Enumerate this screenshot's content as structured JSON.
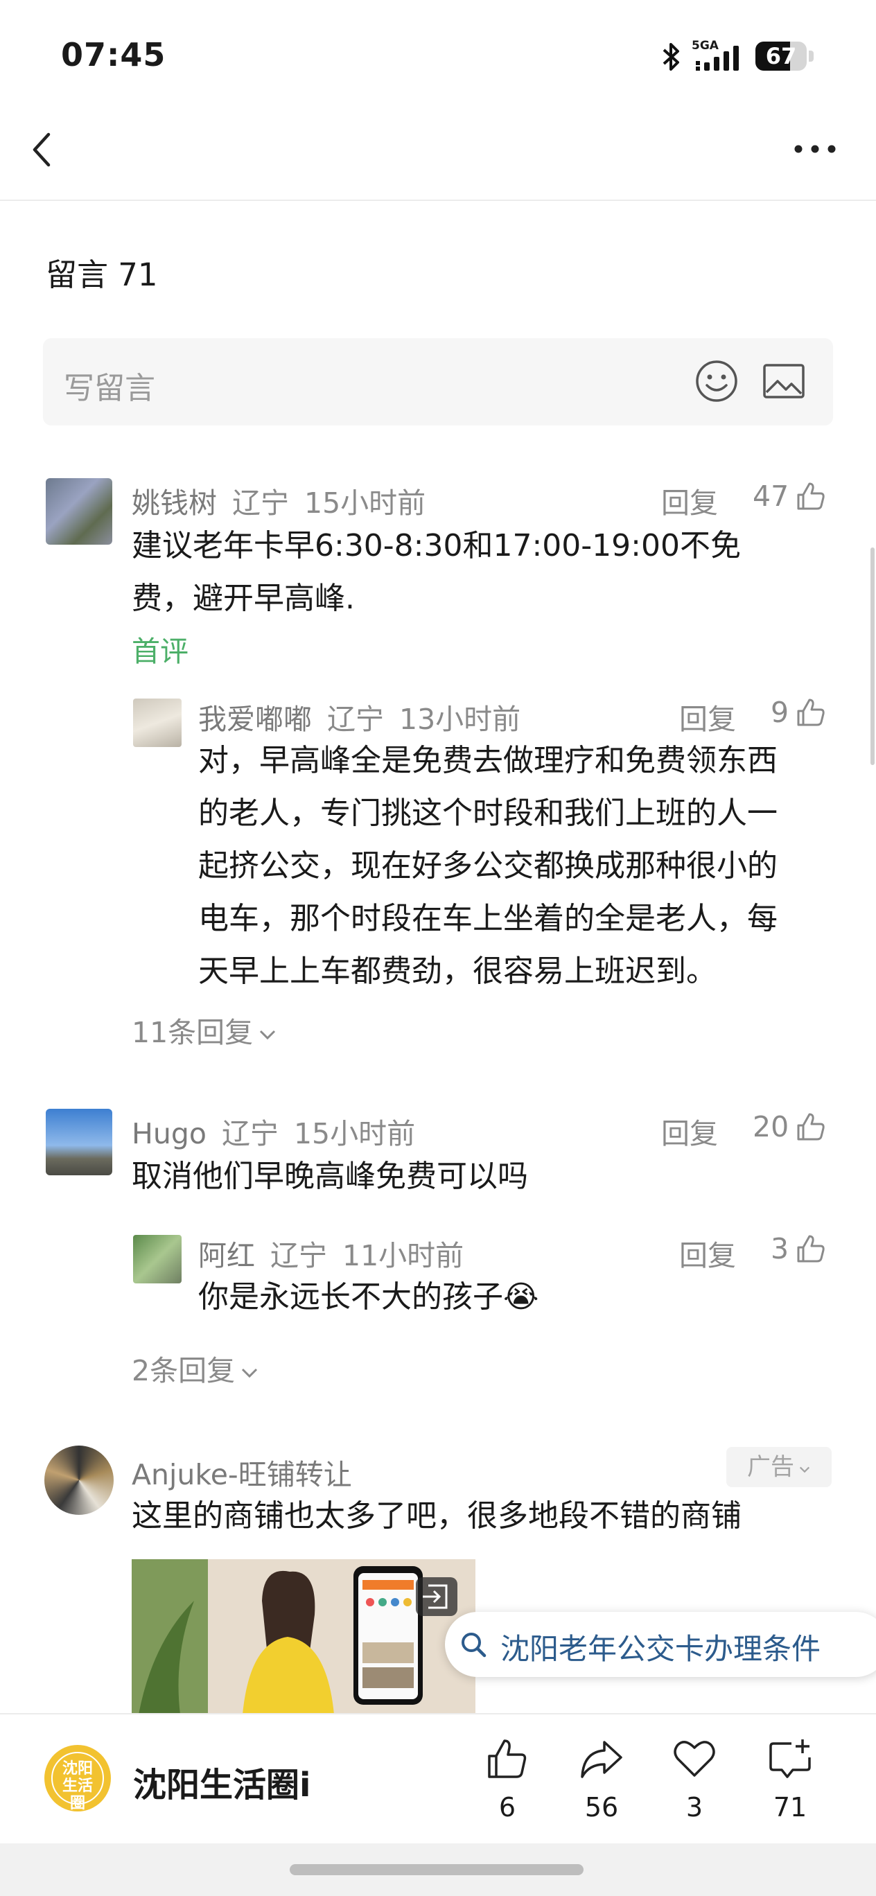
{
  "status_bar": {
    "time": "07:45",
    "network": "5GA",
    "battery": "67",
    "battery_level": 0.67
  },
  "comments_header": {
    "title": "留言 71"
  },
  "write_box": {
    "placeholder": "写留言"
  },
  "comments": [
    {
      "author": "姚钱树",
      "location": "辽宁",
      "time": "15小时前",
      "reply_label": "回复",
      "likes": "47",
      "lines": [
        "建议老年卡早6:30-8:30和17:00-19:00不免",
        "费，避开早高峰."
      ],
      "tag": "首评",
      "replies": [
        {
          "author": "我爱嘟嘟",
          "location": "辽宁",
          "time": "13小时前",
          "reply_label": "回复",
          "likes": "9",
          "lines": [
            "对，早高峰全是免费去做理疗和免费领东西",
            "的老人，专门挑这个时段和我们上班的人一",
            "起挤公交，现在好多公交都换成那种很小的",
            "电车，那个时段在车上坐着的全是老人，每",
            "天早上上车都费劲，很容易上班迟到。"
          ]
        }
      ],
      "more_replies": "11条回复"
    },
    {
      "author": "Hugo",
      "location": "辽宁",
      "time": "15小时前",
      "reply_label": "回复",
      "likes": "20",
      "lines": [
        "取消他们早晚高峰免费可以吗"
      ],
      "replies": [
        {
          "author": "阿红",
          "location": "辽宁",
          "time": "11小时前",
          "reply_label": "回复",
          "likes": "3",
          "lines": [
            "你是永远长不大的孩子😭"
          ]
        }
      ],
      "more_replies": "2条回复"
    }
  ],
  "ad": {
    "author": "Anjuke-旺铺转让",
    "badge": "广告",
    "text": "这里的商铺也太多了吧，很多地段不错的商铺"
  },
  "search_chip": {
    "text": "沈阳老年公交卡办理条件",
    "icon": "search-icon"
  },
  "bottom_bar": {
    "account_name": "沈阳生活圈i",
    "avatar_text": "沈阳生活圈",
    "actions": [
      {
        "icon": "thumbs-up-icon",
        "count": "6"
      },
      {
        "icon": "share-icon",
        "count": "56"
      },
      {
        "icon": "heart-icon",
        "count": "3"
      },
      {
        "icon": "comment-add-icon",
        "count": "71"
      }
    ]
  },
  "colors": {
    "accent_green": "#4caf68",
    "search_blue": "#2c5b8c",
    "avatar_yellow": "#f2c230"
  }
}
